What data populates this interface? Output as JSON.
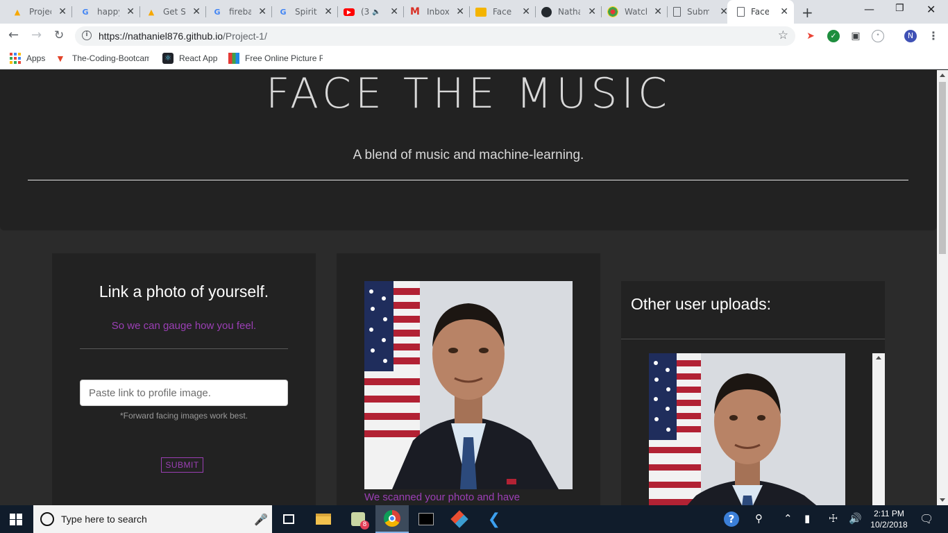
{
  "browser": {
    "tabs": [
      {
        "title": "Project",
        "icon": "firebase-icon"
      },
      {
        "title": "happy",
        "icon": "google-icon"
      },
      {
        "title": "Get Started",
        "icon": "firebase-icon"
      },
      {
        "title": "firebase",
        "icon": "google-icon"
      },
      {
        "title": "Spirit",
        "icon": "google-icon"
      },
      {
        "title": "(3",
        "icon": "youtube-icon"
      },
      {
        "title": "Inbox",
        "icon": "gmail-icon"
      },
      {
        "title": "Face",
        "icon": "slides-icon"
      },
      {
        "title": "Nathaniel",
        "icon": "github-icon"
      },
      {
        "title": "Watch",
        "icon": "watch-icon"
      },
      {
        "title": "Submit",
        "icon": "document-icon"
      },
      {
        "title": "Face The",
        "icon": "document-icon",
        "active": true
      }
    ],
    "url_host": "https://nathaniel876.github.io",
    "url_path": "/Project-1/",
    "profile_initial": "N",
    "bookmarks": [
      {
        "label": "Apps"
      },
      {
        "label": "The-Coding-Bootcam"
      },
      {
        "label": "React App"
      },
      {
        "label": "Free Online Picture R"
      }
    ]
  },
  "page": {
    "site_title": "FACE THE MUSIC",
    "tagline": "A blend of music and machine-learning.",
    "upload_card": {
      "title": "Link a photo of yourself.",
      "subtitle": "So we can gauge how you feel.",
      "input_placeholder": "Paste link to profile image.",
      "hint": "*Forward facing images work best.",
      "submit_label": "SUBMIT"
    },
    "result_card": {
      "result_text": "We scanned your photo and have"
    },
    "uploads_card": {
      "title": "Other user uploads:"
    },
    "colors": {
      "accent": "#9b3fb5",
      "background": "#2b2b2b",
      "card": "#222222"
    }
  },
  "taskbar": {
    "search_placeholder": "Type here to search",
    "time": "2:11 PM",
    "date": "10/2/2018",
    "badge_count": "8"
  }
}
